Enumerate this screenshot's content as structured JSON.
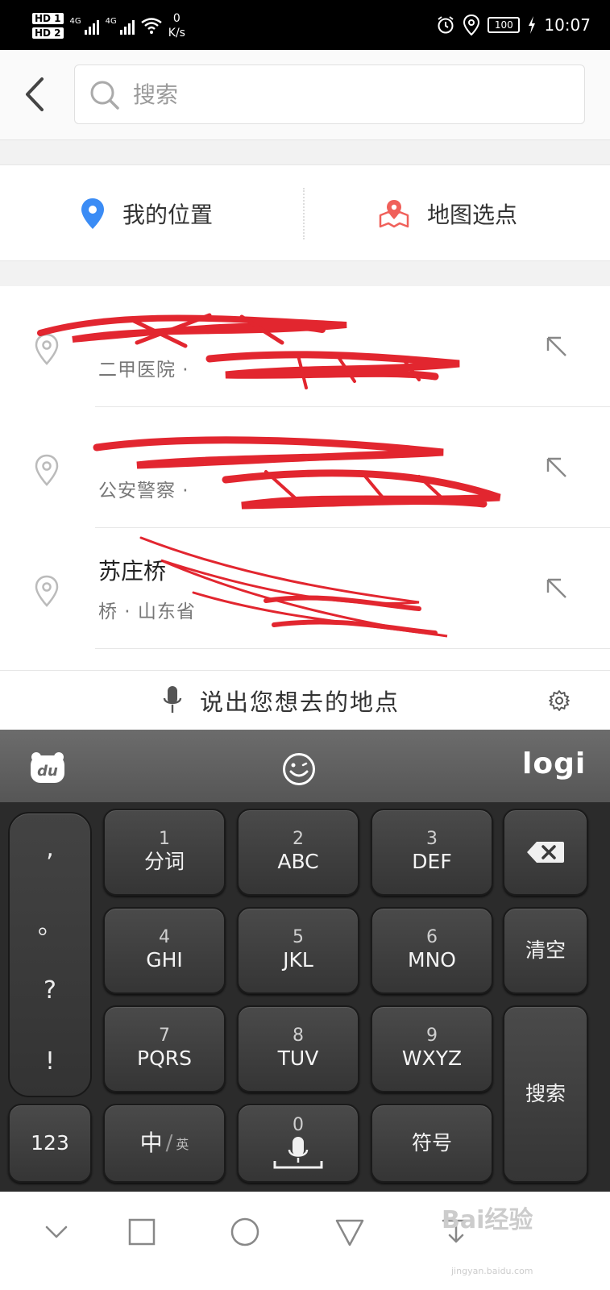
{
  "status_bar": {
    "hd1": "HD 1",
    "hd2": "HD 2",
    "net1": "4G",
    "net2": "4G",
    "speed_value": "0",
    "speed_unit": "K/s",
    "battery": "100",
    "time": "10:07"
  },
  "search": {
    "placeholder": "搜索"
  },
  "location_options": {
    "my_location": "我的位置",
    "map_pick": "地图选点",
    "pin_color": "#3b8cf5",
    "map_color": "#f0605a"
  },
  "results": [
    {
      "title": "",
      "subtitle": "二甲医院 · "
    },
    {
      "title": "",
      "subtitle": "公安警察 · "
    },
    {
      "title": "苏庄桥",
      "subtitle": "桥 · 山东省"
    }
  ],
  "voice": {
    "prompt": "说出您想去的地点"
  },
  "keyboard": {
    "brand": "logi",
    "punct": [
      ",",
      "。",
      "?",
      "!"
    ],
    "keys": [
      {
        "num": "1",
        "letters": "分词"
      },
      {
        "num": "2",
        "letters": "ABC"
      },
      {
        "num": "3",
        "letters": "DEF"
      },
      {
        "num": "4",
        "letters": "GHI"
      },
      {
        "num": "5",
        "letters": "JKL"
      },
      {
        "num": "6",
        "letters": "MNO"
      },
      {
        "num": "7",
        "letters": "PQRS"
      },
      {
        "num": "8",
        "letters": "TUV"
      },
      {
        "num": "9",
        "letters": "WXYZ"
      }
    ],
    "clear": "清空",
    "search": "搜索",
    "numeric": "123",
    "lang_main": "中",
    "lang_sub": "英",
    "zero": "0",
    "symbols": "符号"
  },
  "watermark": {
    "brand": "Bai经验",
    "url": "jingyan.baidu.com"
  }
}
